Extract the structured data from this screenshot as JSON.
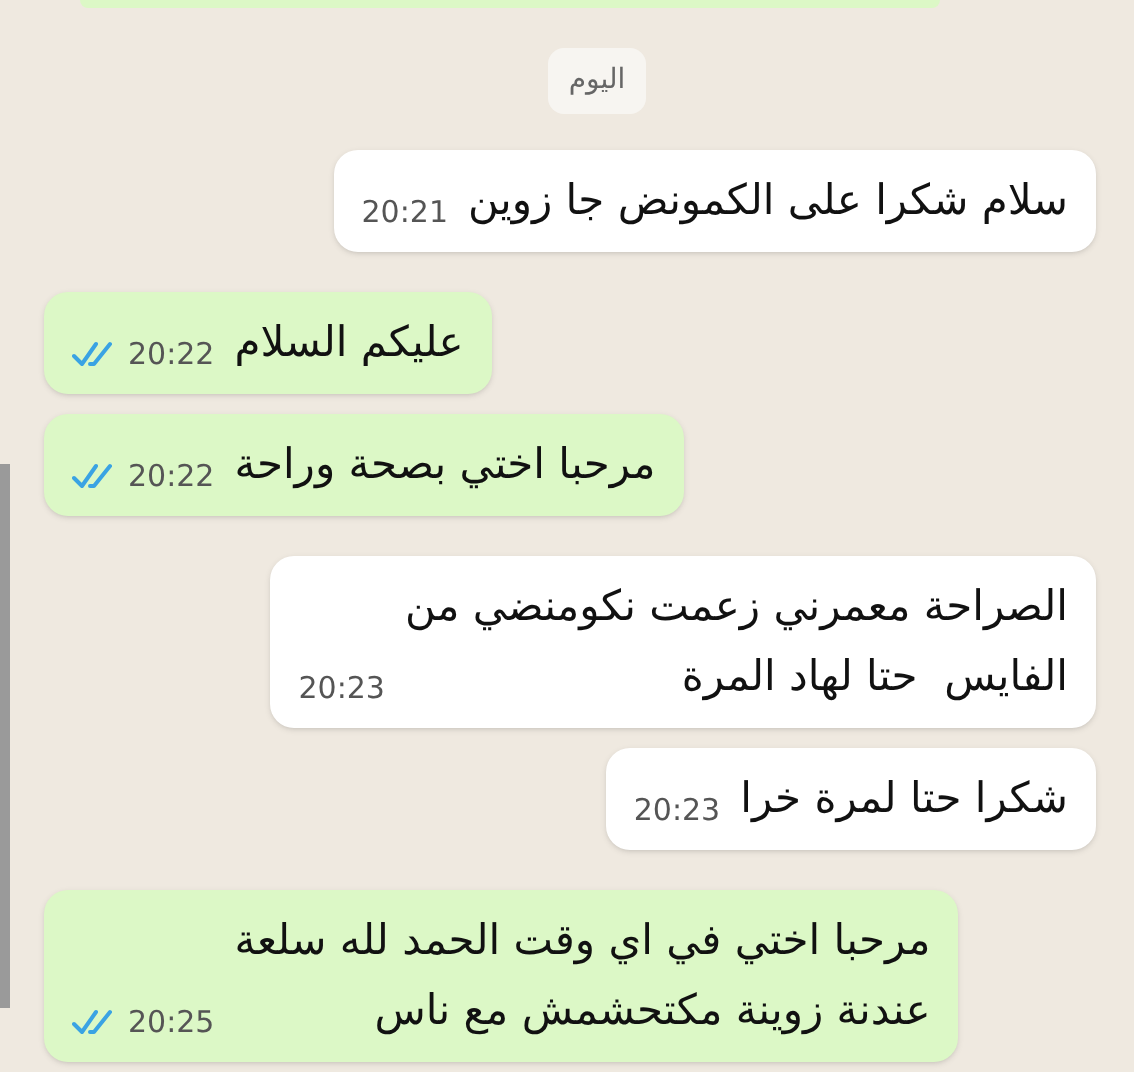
{
  "date_chip": "اليوم",
  "messages": [
    {
      "kind": "incoming",
      "text": "سلام شكرا على الكمونض جا زوين",
      "time": "20:21"
    },
    {
      "kind": "outgoing",
      "text": "عليكم السلام",
      "time": "20:22",
      "read": true
    },
    {
      "kind": "outgoing",
      "text": "مرحبا اختي بصحة وراحة",
      "time": "20:22",
      "read": true
    },
    {
      "kind": "incoming",
      "text": "الصراحة معمرني زعمت نكومنضي من\nالفايس  حتا لهاد المرة",
      "time": "20:23"
    },
    {
      "kind": "incoming",
      "text": "شكرا حتا لمرة خرا",
      "time": "20:23"
    },
    {
      "kind": "outgoing",
      "text": "مرحبا اختي في اي وقت الحمد لله سلعة\nعندنة زوينة مكتحشمش مع ناس",
      "time": "20:25",
      "read": true
    }
  ]
}
